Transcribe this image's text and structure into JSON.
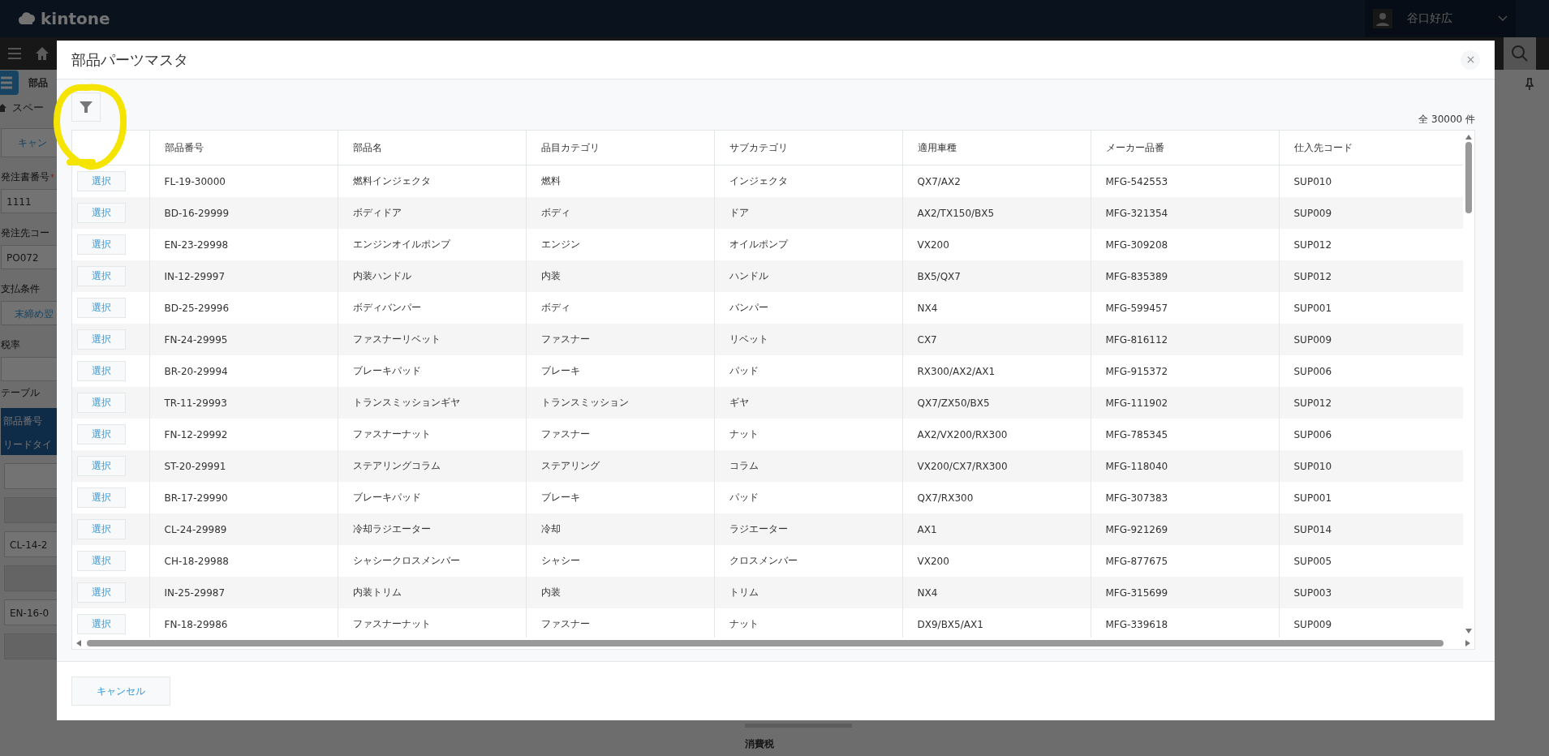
{
  "header": {
    "logo": "kintone",
    "user_name": "谷口好広"
  },
  "background": {
    "app_name": "部品",
    "breadcrumb": "スペー",
    "cancel_partial": "キャン",
    "fields": [
      {
        "label": "発注書番号",
        "required_mark": "*",
        "value": "1111",
        "kind": "text"
      },
      {
        "label": "発注先コー",
        "value": "PO072",
        "kind": "text"
      },
      {
        "label": "支払条件",
        "value": "末締め翌",
        "kind": "link"
      },
      {
        "label": "税率",
        "kind": "text"
      }
    ],
    "table_label": "テーブル",
    "table_headers": [
      "部品番号",
      "リードタイ"
    ],
    "table_values": [
      {
        "kind": "input"
      },
      {
        "kind": "readonly"
      },
      {
        "kind": "input",
        "value": "CL-14-2"
      },
      {
        "kind": "readonly"
      },
      {
        "kind": "input",
        "value": "EN-16-0"
      },
      {
        "kind": "readonly"
      }
    ],
    "tax_label": "消費税"
  },
  "modal": {
    "title": "部品パーツマスタ",
    "count": "全 30000 件",
    "columns": [
      "部品番号",
      "部品名",
      "品目カテゴリ",
      "サブカテゴリ",
      "適用車種",
      "メーカー品番",
      "仕入先コード"
    ],
    "rows": [
      {
        "select": "選択",
        "cells": [
          "FL-19-30000",
          "燃料インジェクタ",
          "燃料",
          "インジェクタ",
          "QX7/AX2",
          "MFG-542553",
          "SUP010"
        ]
      },
      {
        "select": "選択",
        "cells": [
          "BD-16-29999",
          "ボディドア",
          "ボディ",
          "ドア",
          "AX2/TX150/BX5",
          "MFG-321354",
          "SUP009"
        ]
      },
      {
        "select": "選択",
        "cells": [
          "EN-23-29998",
          "エンジンオイルポンプ",
          "エンジン",
          "オイルポンプ",
          "VX200",
          "MFG-309208",
          "SUP012"
        ]
      },
      {
        "select": "選択",
        "cells": [
          "IN-12-29997",
          "内装ハンドル",
          "内装",
          "ハンドル",
          "BX5/QX7",
          "MFG-835389",
          "SUP012"
        ]
      },
      {
        "select": "選択",
        "cells": [
          "BD-25-29996",
          "ボディバンパー",
          "ボディ",
          "バンパー",
          "NX4",
          "MFG-599457",
          "SUP001"
        ]
      },
      {
        "select": "選択",
        "cells": [
          "FN-24-29995",
          "ファスナーリベット",
          "ファスナー",
          "リベット",
          "CX7",
          "MFG-816112",
          "SUP009"
        ]
      },
      {
        "select": "選択",
        "cells": [
          "BR-20-29994",
          "ブレーキパッド",
          "ブレーキ",
          "パッド",
          "RX300/AX2/AX1",
          "MFG-915372",
          "SUP006"
        ]
      },
      {
        "select": "選択",
        "cells": [
          "TR-11-29993",
          "トランスミッションギヤ",
          "トランスミッション",
          "ギヤ",
          "QX7/ZX50/BX5",
          "MFG-111902",
          "SUP012"
        ]
      },
      {
        "select": "選択",
        "cells": [
          "FN-12-29992",
          "ファスナーナット",
          "ファスナー",
          "ナット",
          "AX2/VX200/RX300",
          "MFG-785345",
          "SUP006"
        ]
      },
      {
        "select": "選択",
        "cells": [
          "ST-20-29991",
          "ステアリングコラム",
          "ステアリング",
          "コラム",
          "VX200/CX7/RX300",
          "MFG-118040",
          "SUP010"
        ]
      },
      {
        "select": "選択",
        "cells": [
          "BR-17-29990",
          "ブレーキパッド",
          "ブレーキ",
          "パッド",
          "QX7/RX300",
          "MFG-307383",
          "SUP001"
        ]
      },
      {
        "select": "選択",
        "cells": [
          "CL-24-29989",
          "冷却ラジエーター",
          "冷却",
          "ラジエーター",
          "AX1",
          "MFG-921269",
          "SUP014"
        ]
      },
      {
        "select": "選択",
        "cells": [
          "CH-18-29988",
          "シャシークロスメンバー",
          "シャシー",
          "クロスメンバー",
          "VX200",
          "MFG-877675",
          "SUP005"
        ]
      },
      {
        "select": "選択",
        "cells": [
          "IN-25-29987",
          "内装トリム",
          "内装",
          "トリム",
          "NX4",
          "MFG-315699",
          "SUP003"
        ]
      },
      {
        "select": "選択",
        "cells": [
          "FN-18-29986",
          "ファスナーナット",
          "ファスナー",
          "ナット",
          "DX9/BX5/AX1",
          "MFG-339618",
          "SUP009"
        ]
      }
    ],
    "cancel": "キャンセル"
  }
}
